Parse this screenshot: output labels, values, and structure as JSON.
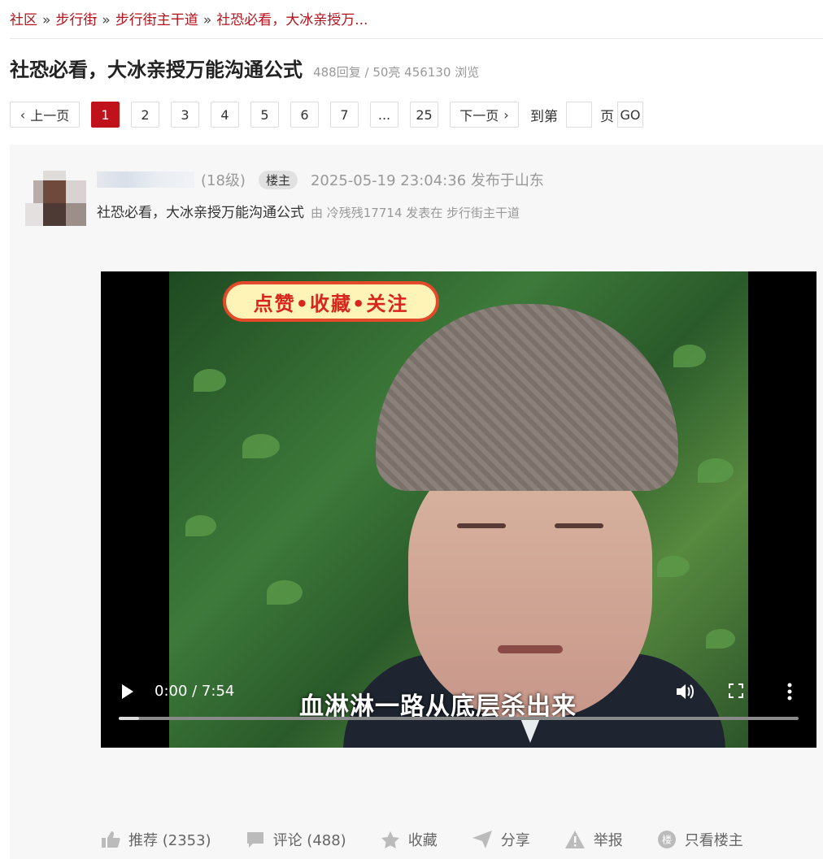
{
  "breadcrumb": {
    "items": [
      "社区",
      "步行街",
      "步行街主干道",
      "社恐必看，大冰亲授万..."
    ],
    "separator": "»"
  },
  "thread": {
    "title": "社恐必看，大冰亲授万能沟通公式",
    "stats": "488回复 / 50亮 456130 浏览"
  },
  "pager": {
    "prev": "上一页",
    "pages": [
      "1",
      "2",
      "3",
      "4",
      "5",
      "6",
      "7",
      "...",
      "25"
    ],
    "active_page": "1",
    "next": "下一页",
    "goto_label": "到第",
    "page_label": "页",
    "go": "GO"
  },
  "post": {
    "level": "(18级)",
    "badge": "楼主",
    "time_location": "2025-05-19 23:04:36  发布于山东",
    "title": "社恐必看，大冰亲授万能沟通公式",
    "meta": "由  冷残残17714 发表在  步行街主干道"
  },
  "video": {
    "sticker": "点赞•收藏•关注",
    "subtitle": "血淋淋一路从底层杀出来",
    "time": "0:00 / 7:54",
    "progress": 0.03
  },
  "actions": {
    "recommend": "推荐 (2353)",
    "comment": "评论 (488)",
    "favorite": "收藏",
    "share": "分享",
    "report": "举报",
    "only_op": "只看楼主",
    "only_op_icon_text": "楼"
  },
  "colors": {
    "accent": "#c0121b",
    "link": "#b4121b"
  }
}
